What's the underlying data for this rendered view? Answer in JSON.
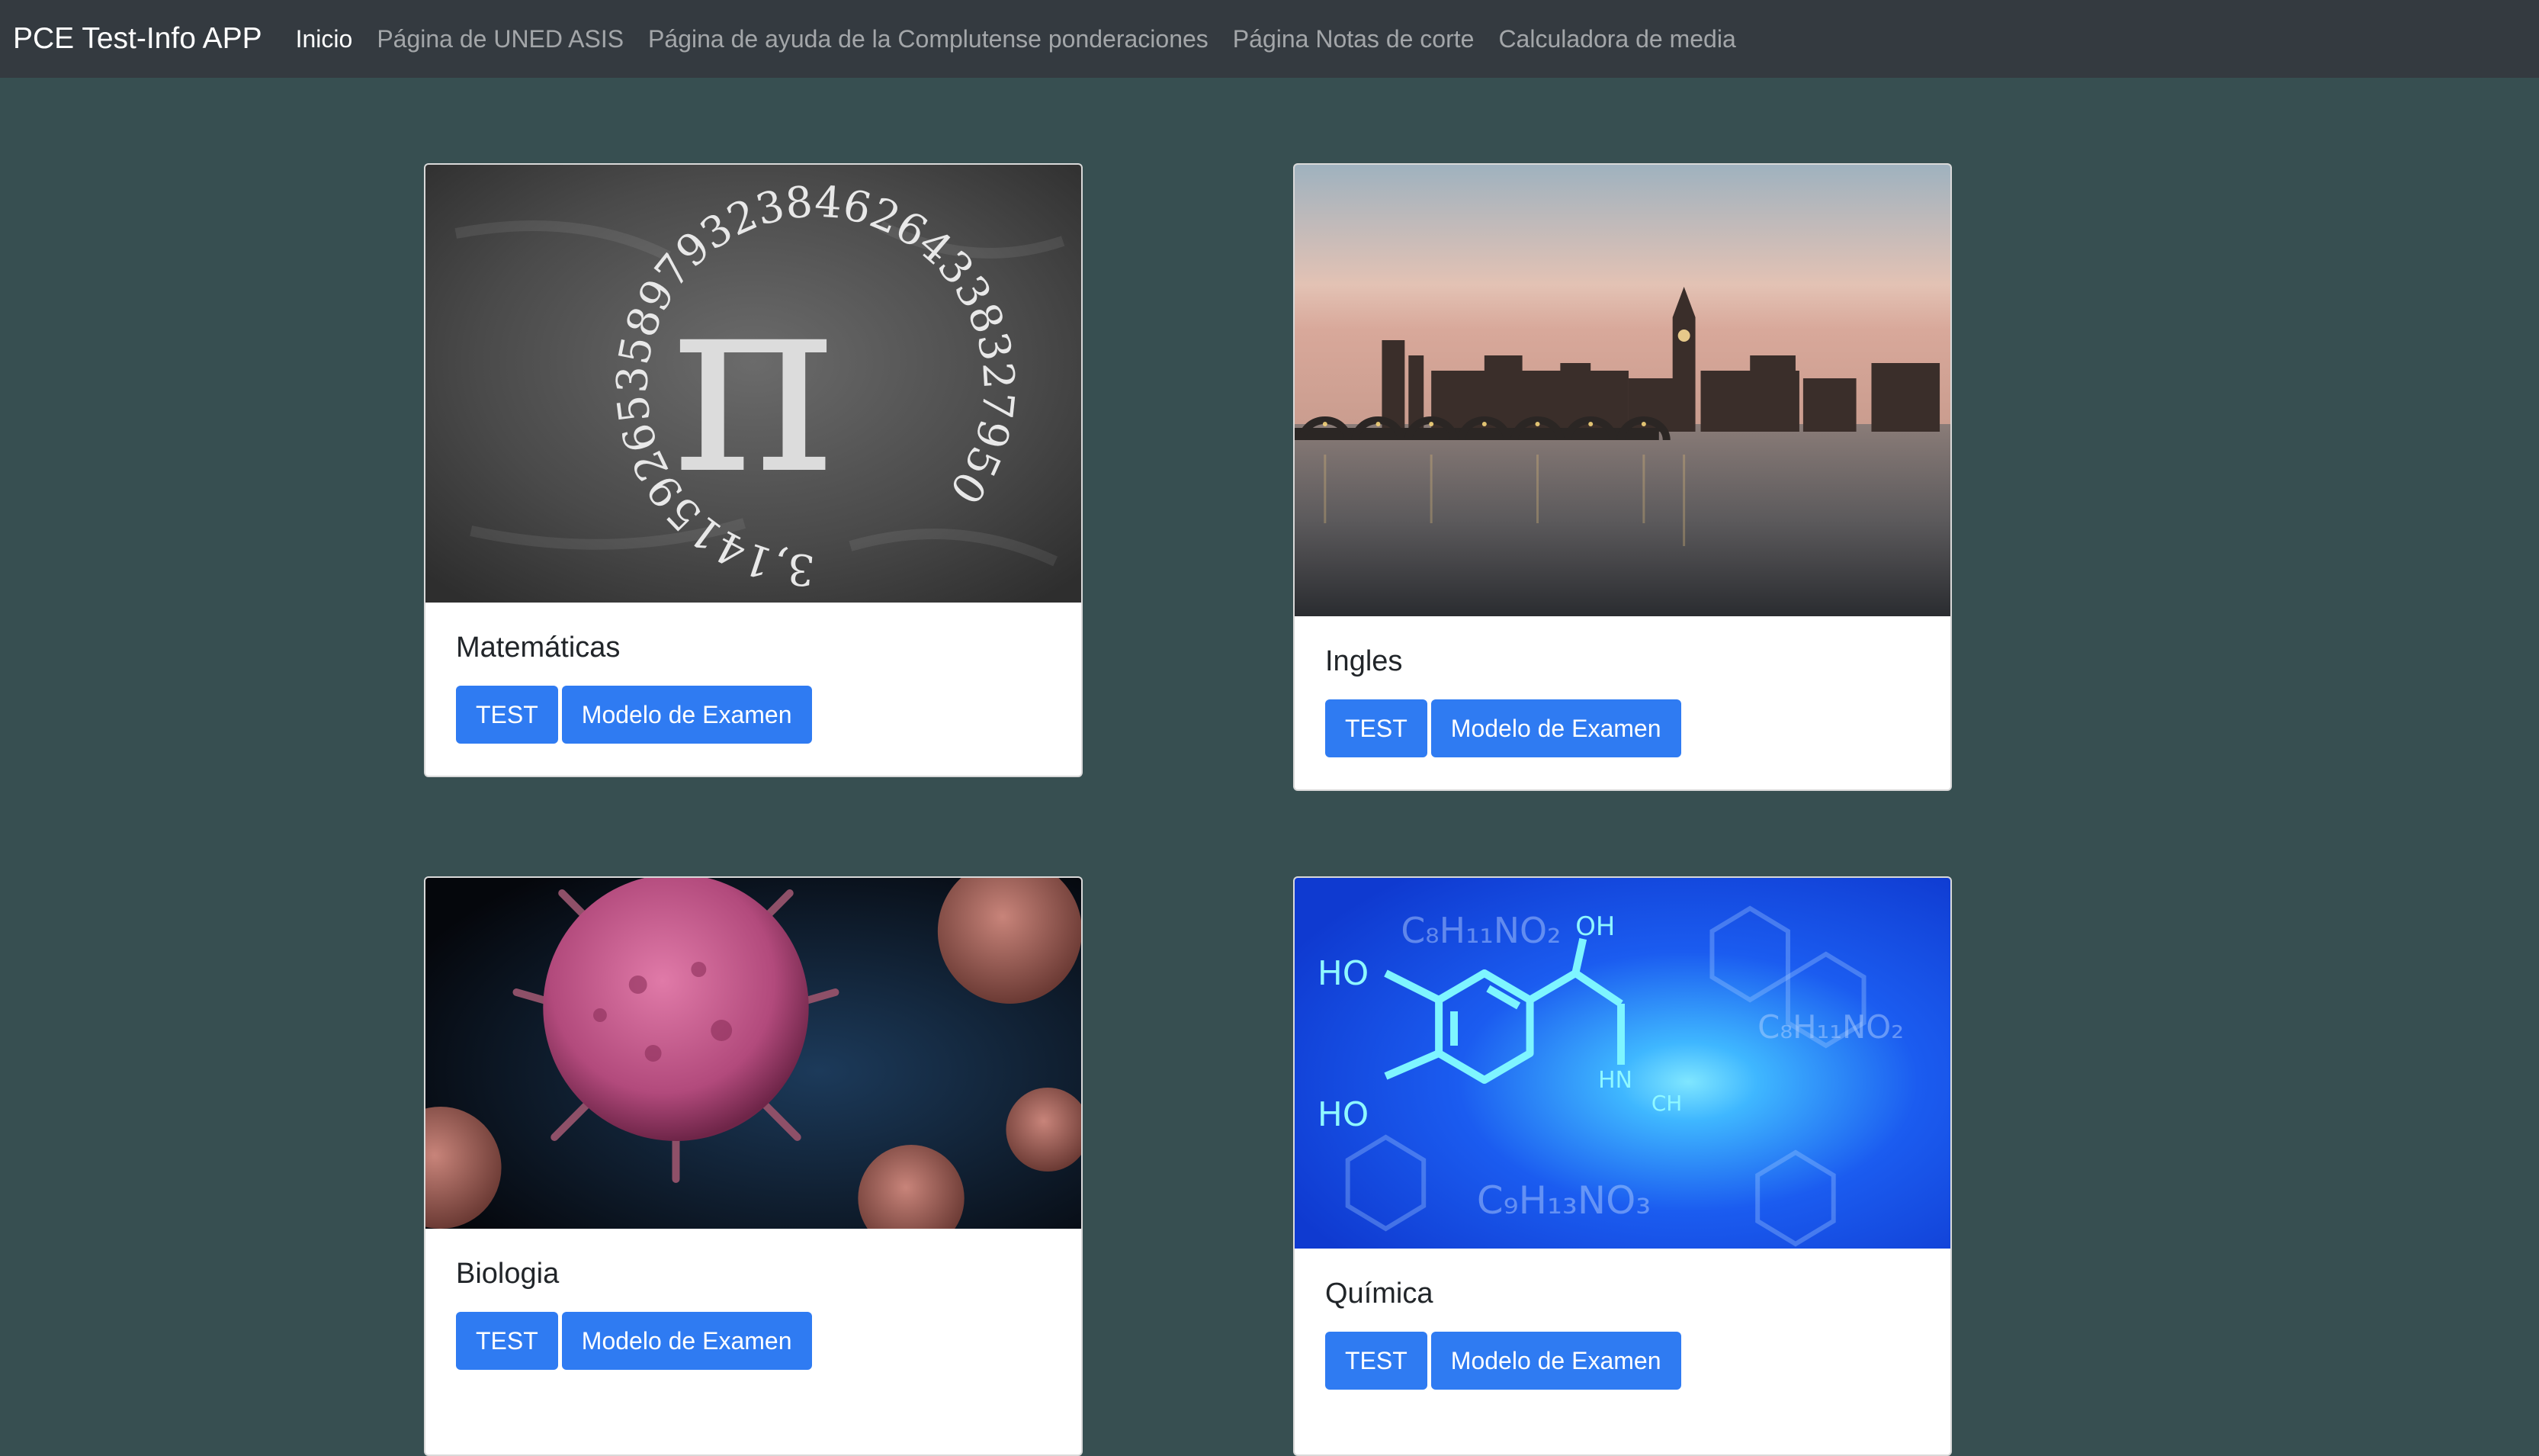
{
  "navbar": {
    "brand": "PCE Test-Info APP",
    "links": [
      {
        "label": "Inicio",
        "active": true
      },
      {
        "label": "Página de UNED ASIS",
        "active": false
      },
      {
        "label": "Página de ayuda de la Complutense ponderaciones",
        "active": false
      },
      {
        "label": "Página Notas de corte",
        "active": false
      },
      {
        "label": "Calculadora de media",
        "active": false
      }
    ]
  },
  "cards": [
    {
      "title": "Matemáticas",
      "image": "chalkboard-pi",
      "test_label": "TEST",
      "exam_label": "Modelo de Examen"
    },
    {
      "title": "Ingles",
      "image": "london-westminster-bridge",
      "test_label": "TEST",
      "exam_label": "Modelo de Examen"
    },
    {
      "title": "Biologia",
      "image": "virus-particles",
      "test_label": "TEST",
      "exam_label": "Modelo de Examen"
    },
    {
      "title": "Química",
      "image": "molecule-structure",
      "test_label": "TEST",
      "exam_label": "Modelo de Examen"
    }
  ],
  "images": {
    "pi_digits": "3,14159265358979323846264338327950",
    "pi_symbol": "π",
    "chem_labels": [
      "HO",
      "OH",
      "HO",
      "HN",
      "CH",
      "C₈H₁₁NO₂",
      "C₈H₁₁NO₂",
      "C₉H₁₃NO₃"
    ]
  },
  "colors": {
    "navbar_bg": "#343a40",
    "page_bg": "#374f51",
    "button": "#2f7bf2"
  }
}
